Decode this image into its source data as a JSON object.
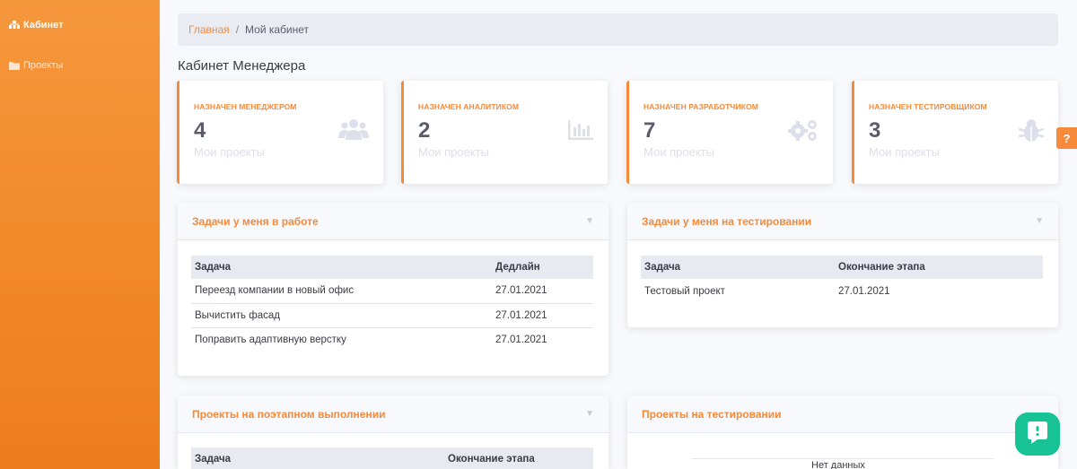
{
  "sidebar": {
    "items": [
      {
        "label": "Кабинет",
        "icon": "sitemap-icon"
      },
      {
        "label": "Проекты",
        "icon": "folder-icon"
      }
    ]
  },
  "breadcrumb": {
    "home": "Главная",
    "separator": "/",
    "current": "Мой кабинет"
  },
  "page_title": "Кабинет Менеджера",
  "stats": [
    {
      "label": "НАЗНАЧЕН МЕНЕДЖЕРОМ",
      "value": "4",
      "sub": "Мои проекты",
      "icon": "users-icon"
    },
    {
      "label": "НАЗНАЧЕН АНАЛИТИКОМ",
      "value": "2",
      "sub": "Мои проекты",
      "icon": "chart-icon"
    },
    {
      "label": "НАЗНАЧЕН РАЗРАБОТЧИКОМ",
      "value": "7",
      "sub": "Мои проекты",
      "icon": "cogs-icon"
    },
    {
      "label": "НАЗНАЧЕН ТЕСТИРОВЩИКОМ",
      "value": "3",
      "sub": "Мои проекты",
      "icon": "bug-icon"
    }
  ],
  "panels": {
    "in_work": {
      "title": "Задачи у меня в работе",
      "columns": [
        "Задача",
        "Дедлайн"
      ],
      "rows": [
        [
          "Переезд компании в новый офис",
          "27.01.2021"
        ],
        [
          "Вычистить фасад",
          "27.01.2021"
        ],
        [
          "Поправить адаптивную верстку",
          "27.01.2021"
        ]
      ]
    },
    "testing": {
      "title": "Задачи у меня на тестировании",
      "columns": [
        "Задача",
        "Окончание этапа"
      ],
      "rows": [
        [
          "Тестовый проект",
          "27.01.2021"
        ]
      ]
    },
    "stages": {
      "title": "Проекты на поэтапном выполнении",
      "columns": [
        "Задача",
        "Окончание этапа"
      ]
    },
    "projects_testing": {
      "title": "Проекты на тестировании",
      "empty": "Нет данных"
    }
  },
  "help_label": "?",
  "colors": {
    "accent": "#f6893a",
    "chat": "#17c294"
  }
}
